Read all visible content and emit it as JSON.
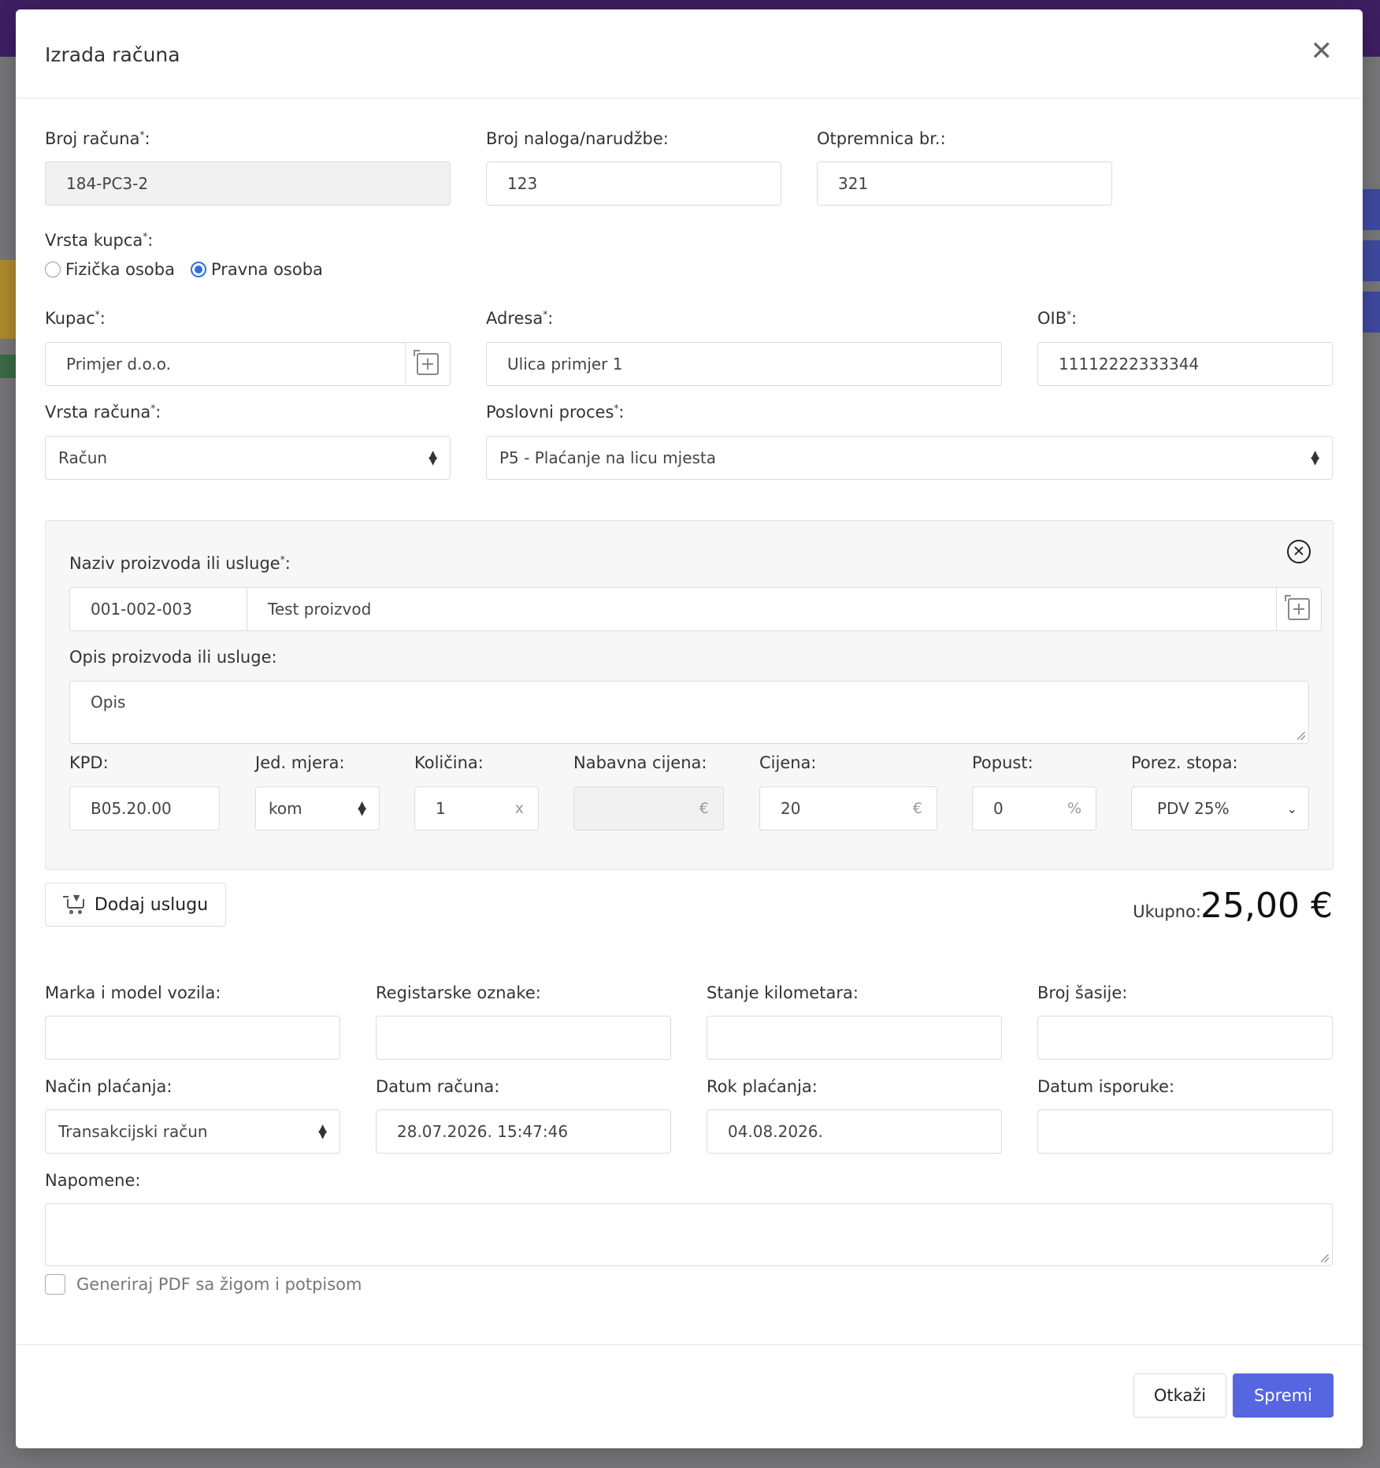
{
  "modal": {
    "title": "Izrada računa"
  },
  "header_fields": {
    "invoice_number_label": "Broj računa",
    "invoice_number_value": "184-PC3-2",
    "order_number_label": "Broj naloga/narudžbe:",
    "order_number_value": "123",
    "delivery_note_label": "Otpremnica br.:",
    "delivery_note_value": "321"
  },
  "customer_type": {
    "label": "Vrsta kupca",
    "options": [
      "Fizička osoba",
      "Pravna osoba"
    ],
    "selected": "Pravna osoba"
  },
  "customer": {
    "buyer_label": "Kupac",
    "buyer_value": "Primjer d.o.o.",
    "address_label": "Adresa",
    "address_value": "Ulica primjer 1",
    "oib_label": "OIB",
    "oib_value": "11112222333344"
  },
  "invoice_type": {
    "label": "Vrsta računa",
    "value": "Račun"
  },
  "business_process": {
    "label": "Poslovni proces",
    "value": "P5 - Plaćanje na licu mjesta"
  },
  "item": {
    "name_label": "Naziv proizvoda ili usluge",
    "code_value": "001-002-003",
    "name_value": "Test proizvod",
    "description_label": "Opis proizvoda ili usluge:",
    "description_value": "Opis",
    "kpd_label": "KPD:",
    "kpd_value": "B05.20.00",
    "unit_label": "Jed. mjera:",
    "unit_value": "kom",
    "quantity_label": "Količina:",
    "quantity_value": "1",
    "quantity_suffix": "x",
    "purchase_price_label": "Nabavna cijena:",
    "purchase_price_value": "",
    "price_label": "Cijena:",
    "price_value": "20",
    "currency_suffix": "€",
    "discount_label": "Popust:",
    "discount_value": "0",
    "discount_suffix": "%",
    "tax_label": "Porez. stopa:",
    "tax_value": "PDV 25%"
  },
  "add_service_label": "Dodaj uslugu",
  "total": {
    "label": "Ukupno:",
    "value": "25,00 €"
  },
  "vehicle": {
    "make_model_label": "Marka i model vozila:",
    "make_model_value": "",
    "plates_label": "Registarske oznake:",
    "plates_value": "",
    "mileage_label": "Stanje kilometara:",
    "mileage_value": "",
    "chassis_label": "Broj šasije:",
    "chassis_value": ""
  },
  "payment": {
    "method_label": "Način plaćanja:",
    "method_value": "Transakcijski račun",
    "date_label": "Datum računa:",
    "date_value": "28.07.2026. 15:47:46",
    "due_label": "Rok plaćanja:",
    "due_value": "04.08.2026.",
    "delivery_label": "Datum isporuke:",
    "delivery_value": ""
  },
  "notes": {
    "label": "Napomene:",
    "value": ""
  },
  "pdf_checkbox_label": "Generiraj PDF sa žigom i potpisom",
  "footer": {
    "cancel_label": "Otkaži",
    "save_label": "Spremi"
  },
  "colors": {
    "primary": "#5566e0",
    "radio_selected": "#2f6fe0",
    "topbar": "#3d1f62"
  }
}
